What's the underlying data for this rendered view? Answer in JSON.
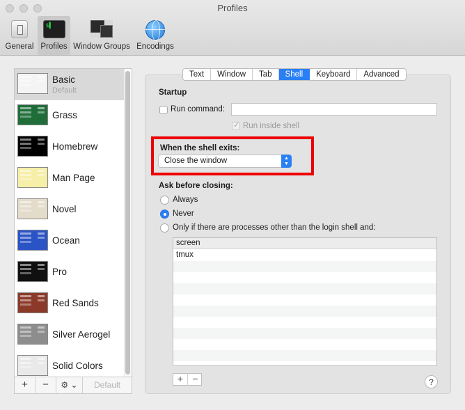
{
  "window": {
    "title": "Profiles"
  },
  "toolbar": {
    "items": [
      {
        "label": "General",
        "icon": "general-switch-icon"
      },
      {
        "label": "Profiles",
        "icon": "terminal-icon",
        "glyph": "$▌"
      },
      {
        "label": "Window Groups",
        "icon": "window-groups-icon",
        "glyph": "$▌"
      },
      {
        "label": "Encodings",
        "icon": "globe-icon"
      }
    ],
    "selected": "Profiles"
  },
  "profiles": {
    "items": [
      {
        "name": "Basic",
        "subtitle": "Default",
        "color": "#f4f4f4"
      },
      {
        "name": "Grass",
        "color": "#1f6e3a"
      },
      {
        "name": "Homebrew",
        "color": "#000000"
      },
      {
        "name": "Man Page",
        "color": "#f6efa8"
      },
      {
        "name": "Novel",
        "color": "#e3dccb"
      },
      {
        "name": "Ocean",
        "color": "#2a53c6"
      },
      {
        "name": "Pro",
        "color": "#101010"
      },
      {
        "name": "Red Sands",
        "color": "#8b3a2a"
      },
      {
        "name": "Silver Aerogel",
        "color": "#8d8d8d"
      },
      {
        "name": "Solid Colors",
        "color": "#e9e9e9"
      }
    ],
    "selected": "Basic",
    "bottom_bar": {
      "add": "+",
      "remove": "−",
      "gear": "⚙︎ ⌄",
      "default": "Default"
    }
  },
  "tabs": {
    "items": [
      "Text",
      "Window",
      "Tab",
      "Shell",
      "Keyboard",
      "Advanced"
    ],
    "active": "Shell"
  },
  "shell": {
    "startup_heading": "Startup",
    "run_command_label": "Run command:",
    "run_command_value": "",
    "run_inside_shell_label": "Run inside shell",
    "exit_heading": "When the shell exits:",
    "exit_action": "Close the window",
    "ask_heading": "Ask before closing:",
    "ask_options": [
      "Always",
      "Never",
      "Only if there are processes other than the login shell and:"
    ],
    "ask_selected": "Never",
    "processes": [
      "screen",
      "tmux"
    ],
    "add": "+",
    "remove": "−",
    "help": "?"
  },
  "colors": {
    "accent": "#2a7ff5",
    "highlight": "#ee0000"
  }
}
